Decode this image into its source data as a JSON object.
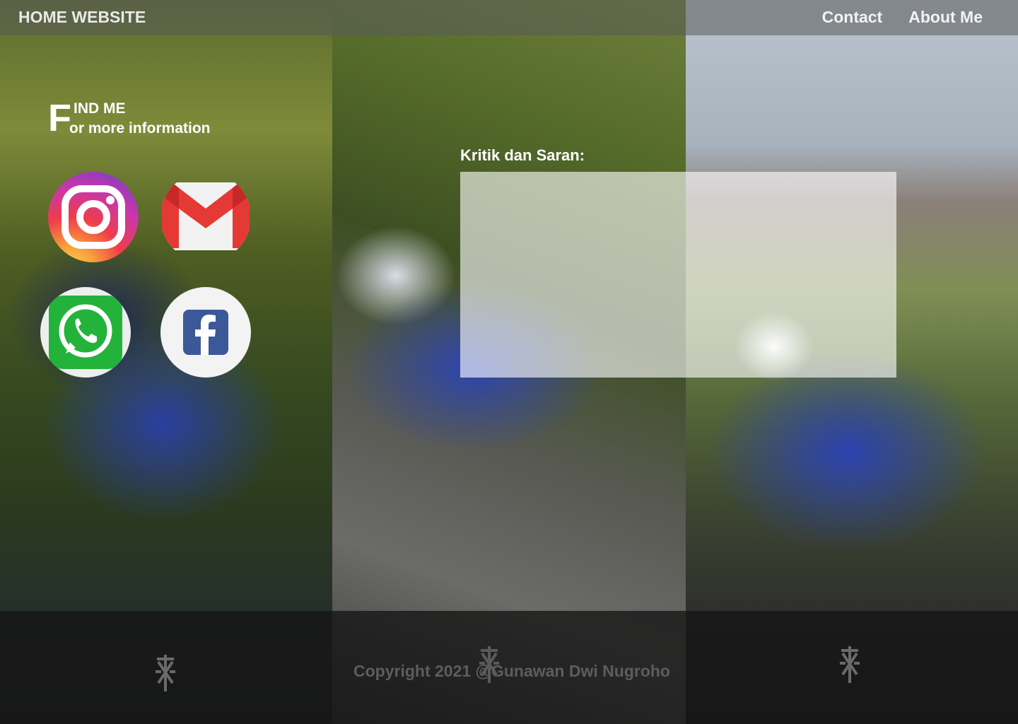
{
  "nav": {
    "title": "HOME WEBSITE",
    "links": [
      "Contact",
      "About Me"
    ]
  },
  "findme": {
    "big_letter": "F",
    "line1": "IND ME",
    "line2": "or more information"
  },
  "social": [
    {
      "name": "instagram",
      "icon": "instagram-icon"
    },
    {
      "name": "gmail",
      "icon": "gmail-icon"
    },
    {
      "name": "whatsapp",
      "icon": "whatsapp-icon"
    },
    {
      "name": "facebook",
      "icon": "facebook-icon"
    }
  ],
  "form": {
    "label": "Kritik dan Saran:",
    "value": ""
  },
  "footer": {
    "copyright": "Copyright 2021 @Gunawan Dwi Nugroho"
  },
  "colors": {
    "nav_bar": "#5a5a5a",
    "footer": "#141414",
    "form_bg": "#ffffff"
  }
}
